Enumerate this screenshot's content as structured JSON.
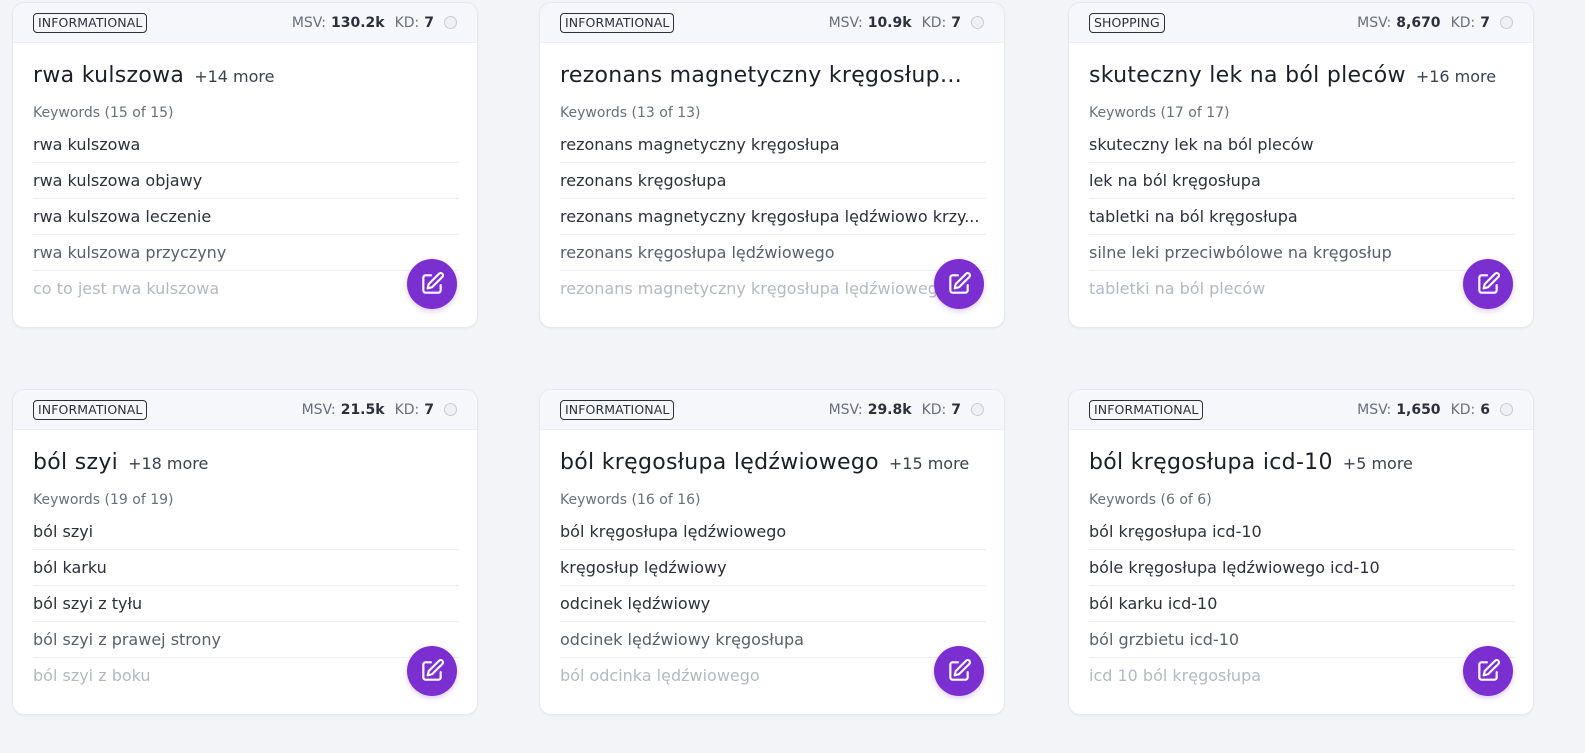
{
  "cards": [
    {
      "intent": "INFORMATIONAL",
      "msv_label": "MSV:",
      "msv": "130.2k",
      "kd_label": "KD:",
      "kd": "7",
      "title": "rwa kulszowa",
      "more": "+14 more",
      "keywords_heading": "Keywords (15 of 15)",
      "keywords": [
        "rwa kulszowa",
        "rwa kulszowa objawy",
        "rwa kulszowa leczenie",
        "rwa kulszowa przyczyny",
        "co to jest rwa kulszowa"
      ]
    },
    {
      "intent": "INFORMATIONAL",
      "msv_label": "MSV:",
      "msv": "10.9k",
      "kd_label": "KD:",
      "kd": "7",
      "title": "rezonans magnetyczny kręgosłupa...",
      "more": "",
      "keywords_heading": "Keywords (13 of 13)",
      "keywords": [
        "rezonans magnetyczny kręgosłupa",
        "rezonans kręgosłupa",
        "rezonans magnetyczny kręgosłupa lędźwiowo krzy...",
        "rezonans kręgosłupa lędźwiowego",
        "rezonans magnetyczny kręgosłupa lędźwiowego"
      ]
    },
    {
      "intent": "SHOPPING",
      "msv_label": "MSV:",
      "msv": "8,670",
      "kd_label": "KD:",
      "kd": "7",
      "title": "skuteczny lek na ból pleców",
      "more": "+16 more",
      "keywords_heading": "Keywords (17 of 17)",
      "keywords": [
        "skuteczny lek na ból pleców",
        "lek na ból kręgosłupa",
        "tabletki na ból kręgosłupa",
        "silne leki przeciwbólowe na kręgosłup",
        "tabletki na ból pleców"
      ]
    },
    {
      "intent": "INFORMATIONAL",
      "msv_label": "MSV:",
      "msv": "21.5k",
      "kd_label": "KD:",
      "kd": "7",
      "title": "ból szyi",
      "more": "+18 more",
      "keywords_heading": "Keywords (19 of 19)",
      "keywords": [
        "ból szyi",
        "ból karku",
        "ból szyi z tyłu",
        "ból szyi z prawej strony",
        "ból szyi z boku"
      ]
    },
    {
      "intent": "INFORMATIONAL",
      "msv_label": "MSV:",
      "msv": "29.8k",
      "kd_label": "KD:",
      "kd": "7",
      "title": "ból kręgosłupa lędźwiowego",
      "more": "+15 more",
      "keywords_heading": "Keywords (16 of 16)",
      "keywords": [
        "ból kręgosłupa lędźwiowego",
        "kręgosłup lędźwiowy",
        "odcinek lędźwiowy",
        "odcinek lędźwiowy kręgosłupa",
        "ból odcinka lędźwiowego"
      ]
    },
    {
      "intent": "INFORMATIONAL",
      "msv_label": "MSV:",
      "msv": "1,650",
      "kd_label": "KD:",
      "kd": "6",
      "title": "ból kręgosłupa icd-10",
      "more": "+5 more",
      "keywords_heading": "Keywords (6 of 6)",
      "keywords": [
        "ból kręgosłupa icd-10",
        "bóle kręgosłupa lędźwiowego icd-10",
        "ból karku icd-10",
        "ból grzbietu icd-10",
        "icd 10 ból kręgosłupa"
      ]
    }
  ],
  "colors": {
    "accent": "#7b2fd1",
    "background": "#f3f4f8",
    "card": "#ffffff"
  },
  "icons": {
    "edit": "edit-pencil-icon",
    "select": "select-circle"
  }
}
